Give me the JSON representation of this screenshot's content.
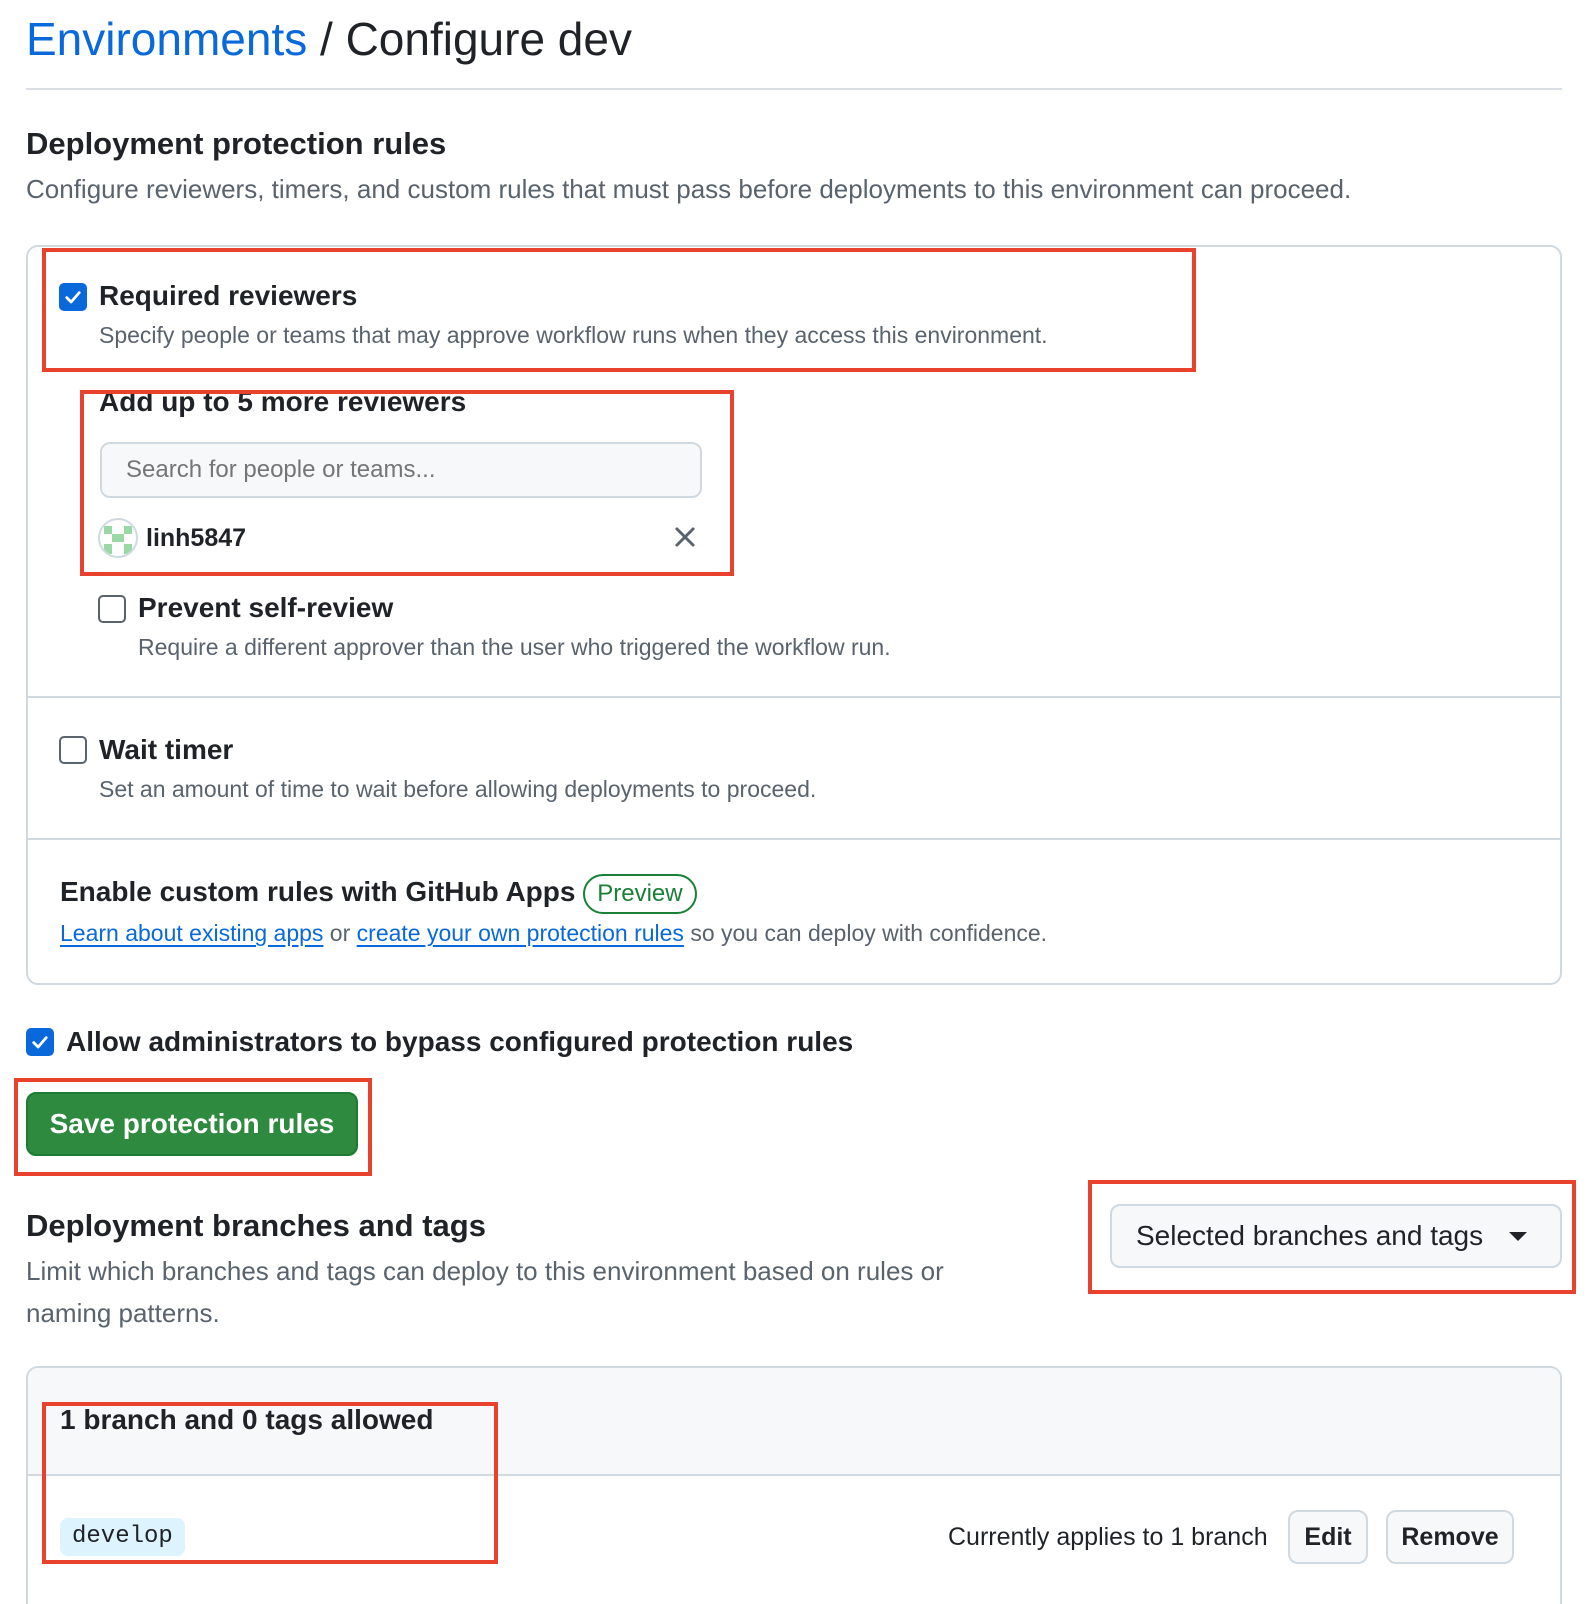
{
  "breadcrumb": {
    "parent": "Environments",
    "separator": " / ",
    "current": "Configure dev"
  },
  "protection": {
    "heading": "Deployment protection rules",
    "description": "Configure reviewers, timers, and custom rules that must pass before deployments to this environment can proceed.",
    "required_reviewers": {
      "label": "Required reviewers",
      "checked": true,
      "description": "Specify people or teams that may approve workflow runs when they access this environment.",
      "add_label": "Add up to 5 more reviewers",
      "search_placeholder": "Search for people or teams...",
      "reviewers": [
        {
          "name": "linh5847",
          "avatar_icon": "identicon-avatar",
          "remove_icon": "close-icon"
        }
      ]
    },
    "prevent_self_review": {
      "label": "Prevent self-review",
      "checked": false,
      "description": "Require a different approver than the user who triggered the workflow run."
    },
    "wait_timer": {
      "label": "Wait timer",
      "checked": false,
      "description": "Set an amount of time to wait before allowing deployments to proceed."
    },
    "custom_rules": {
      "label": "Enable custom rules with GitHub Apps",
      "badge": "Preview",
      "link1": "Learn about existing apps",
      "middle": " or ",
      "link2": "create your own protection rules",
      "suffix": " so you can deploy with confidence."
    },
    "admin_bypass": {
      "label": "Allow administrators to bypass configured protection rules",
      "checked": true
    },
    "save_label": "Save protection rules"
  },
  "branches": {
    "heading": "Deployment branches and tags",
    "description_line1": "Limit which branches and tags can deploy to this environment based on rules or",
    "description_line2": "naming patterns.",
    "selector": {
      "value": "Selected branches and tags",
      "icon": "triangle-down-icon"
    },
    "summary": "1 branch and 0 tags allowed",
    "rules": [
      {
        "pattern": "develop",
        "applies": "Currently applies to 1 branch",
        "edit_label": "Edit",
        "remove_label": "Remove"
      }
    ]
  },
  "colors": {
    "link": "#0969da",
    "checkbox_checked": "#0969da",
    "primary_button": "#2d8a3e",
    "badge": "#1a7f37",
    "annotation_box": "#e8412d"
  }
}
